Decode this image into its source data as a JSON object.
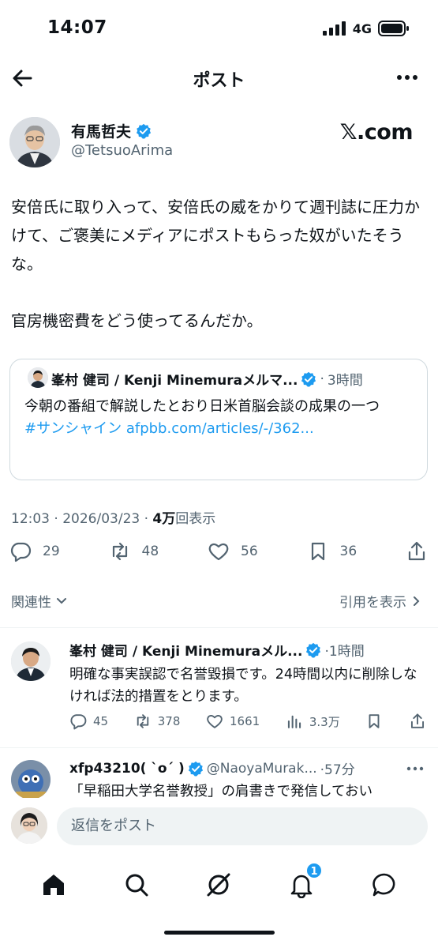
{
  "status": {
    "time": "14:07",
    "network": "4G"
  },
  "nav": {
    "title": "ポスト"
  },
  "post": {
    "author_name": "有馬哲夫",
    "handle": "@TetsuoArima",
    "brand": "𝕏.com",
    "paragraphs": [
      "安倍氏に取り入って、安倍氏の威をかりて週刊誌に圧力かけて、ご褒美にメディアにポストもらった奴がいたそうな。",
      "官房機密費をどう使ってるんだか。"
    ],
    "quote": {
      "author": "峯村 健司 / Kenji Minemuraメルマ...",
      "separator": "·",
      "time": "3時間",
      "text": "今朝の番組で解説したとおり日米首脳会談の成果の一つ",
      "hashtag": "#サンシャイン",
      "link": "afpbb.com/articles/-/362..."
    },
    "meta": {
      "time": "12:03",
      "dot": "·",
      "date": "2026/03/23",
      "dot2": "·",
      "views": "4万",
      "views_label": "回表示"
    },
    "actions": {
      "replies": "29",
      "reposts": "48",
      "likes": "56",
      "bookmarks": "36"
    },
    "relevance": "関連性",
    "view_quotes": "引用を表示"
  },
  "replies": [
    {
      "name": "峯村 健司 / Kenji Minemuraメル...",
      "time": "·1時間",
      "text": "明確な事実誤認で名誉毀損です。24時間以内に削除しなければ法的措置をとります。",
      "replies": "45",
      "reposts": "378",
      "likes": "1661",
      "views": "3.3万"
    },
    {
      "name": "xfp43210( `o´ )",
      "handle": "@NaoyaMurak...",
      "time": "·57分",
      "text": "「早稲田大学名誉教授」の肩書きで発信しておい"
    }
  ],
  "composer": {
    "placeholder": "返信をポスト"
  },
  "tabbar": {
    "notification_count": "1"
  },
  "colors": {
    "accent": "#1d9bf0",
    "text": "#0f1419",
    "secondary": "#536471",
    "border": "#cfd9de"
  }
}
